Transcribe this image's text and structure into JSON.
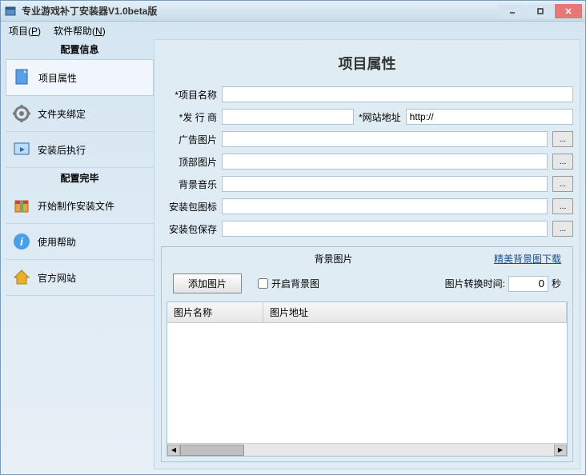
{
  "window": {
    "title": "专业游戏补丁安装器V1.0beta版"
  },
  "menu": {
    "project": "项目(",
    "project_u": "P",
    "project_end": ")",
    "help": "软件帮助(",
    "help_u": "N",
    "help_end": ")"
  },
  "sidebar": {
    "section1": "配置信息",
    "items1": [
      {
        "label": "项目属性"
      },
      {
        "label": "文件夹绑定"
      },
      {
        "label": "安装后执行"
      }
    ],
    "section2": "配置完毕",
    "items2": [
      {
        "label": "开始制作安装文件"
      },
      {
        "label": "使用帮助"
      },
      {
        "label": "官方网站"
      }
    ]
  },
  "page": {
    "title": "项目属性"
  },
  "form": {
    "project_name_label": "*项目名称",
    "project_name_value": "",
    "publisher_label": "*发 行 商",
    "publisher_value": "",
    "website_label": "*网站地址",
    "website_value": "http://",
    "ad_image_label": "广告图片",
    "ad_image_value": "",
    "top_image_label": "顶部图片",
    "top_image_value": "",
    "bg_music_label": "背景音乐",
    "bg_music_value": "",
    "pkg_icon_label": "安装包图标",
    "pkg_icon_value": "",
    "pkg_save_label": "安装包保存",
    "pkg_save_value": "",
    "browse": "..."
  },
  "bg_panel": {
    "title": "背景图片",
    "download_link": "精美背景图下载",
    "add_button": "添加图片",
    "enable_checkbox": "开启背景图",
    "switch_time_label": "图片转换时间:",
    "switch_time_value": "0",
    "switch_time_unit": "秒",
    "col_name": "图片名称",
    "col_addr": "图片地址"
  }
}
